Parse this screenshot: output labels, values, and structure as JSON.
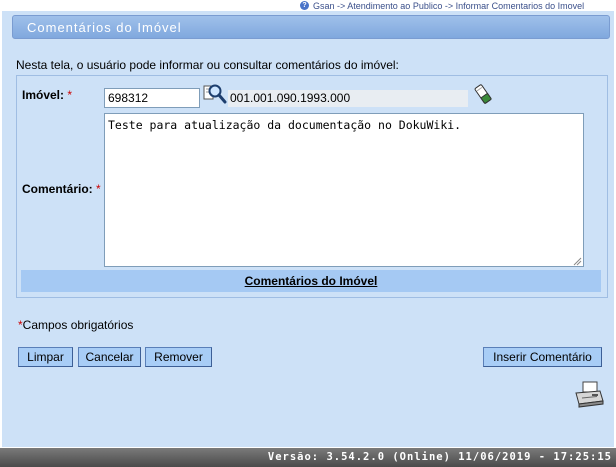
{
  "breadcrumb": {
    "text": "Gsan -> Atendimento ao Publico -> Informar Comentarios do Imovel"
  },
  "page": {
    "title": "Comentários do Imóvel",
    "intro": "Nesta tela, o usuário pode informar ou consultar comentários do imóvel:"
  },
  "form": {
    "imovel_label": "Imóvel:",
    "required_mark": "*",
    "imovel_value": "698312",
    "inscricao_value": "001.001.090.1993.000",
    "comentario_label": "Comentário:",
    "comentario_value": "Teste para atualização da documentação no DokuWiki.",
    "section_header": "Comentários do Imóvel",
    "required_note": "Campos obrigatórios"
  },
  "buttons": {
    "limpar": "Limpar",
    "cancelar": "Cancelar",
    "remover": "Remover",
    "inserir": "Inserir Comentário"
  },
  "footer": {
    "version": "Versão: 3.54.2.0 (Online) 11/06/2019 - 17:25:15"
  },
  "icons": {
    "help": "help-icon",
    "search": "magnifier-icon",
    "clear": "eraser-icon",
    "print": "printer-icon"
  },
  "colors": {
    "background": "#cde1f7",
    "title_bar": "#80a8de",
    "sub_header": "#a5c9f3",
    "button": "#a8cdf6",
    "required": "#cc0000"
  }
}
